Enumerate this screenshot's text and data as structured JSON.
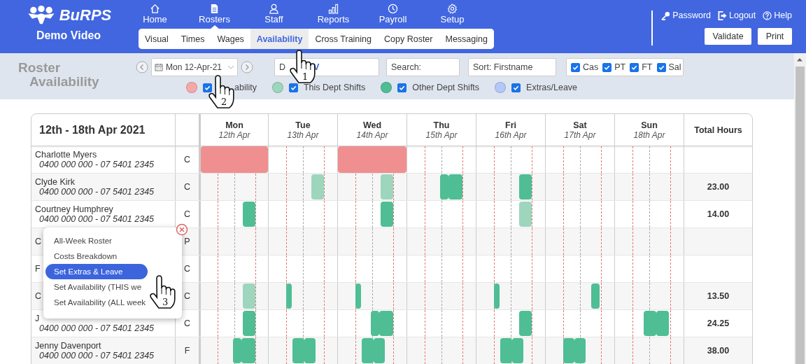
{
  "brand": {
    "logo": "BuRPS",
    "subtitle": "Demo Video"
  },
  "nav": [
    {
      "label": "Home",
      "selected": false
    },
    {
      "label": "Rosters",
      "selected": true
    },
    {
      "label": "Staff",
      "selected": false
    },
    {
      "label": "Reports",
      "selected": false
    },
    {
      "label": "Payroll",
      "selected": false
    },
    {
      "label": "Setup",
      "selected": false
    }
  ],
  "subnav": [
    {
      "label": "Visual",
      "selected": false
    },
    {
      "label": "Times",
      "selected": false
    },
    {
      "label": "Wages",
      "selected": false
    },
    {
      "label": "Availability",
      "selected": true
    },
    {
      "label": "Cross Training",
      "selected": false
    },
    {
      "label": "Copy Roster",
      "selected": false
    },
    {
      "label": "Messaging",
      "selected": false
    }
  ],
  "account_links": [
    "Password",
    "Logout",
    "Help"
  ],
  "buttons": [
    "Validate",
    "Print"
  ],
  "toolbar": {
    "title": [
      "Roster",
      "Availability"
    ],
    "date": "Mon 12-Apr-21",
    "department": {
      "label": "D",
      "value": "V"
    },
    "search": {
      "placeholder": "Search:"
    },
    "sort": "Sort: Firstname",
    "employment": [
      {
        "label": "Cas",
        "checked": true
      },
      {
        "label": "PT",
        "checked": true
      },
      {
        "label": "FT",
        "checked": true
      },
      {
        "label": "Sal",
        "checked": true
      }
    ],
    "legend": [
      {
        "label": "ability",
        "color": "#f4a9a9",
        "checked": true
      },
      {
        "label": "This Dept Shifts",
        "color": "#9dd6bd",
        "checked": true
      },
      {
        "label": "Other Dept Shifts",
        "color": "#4fbe95",
        "checked": true
      },
      {
        "label": "Extras/Leave",
        "color": "#b3c8f7",
        "checked": true
      }
    ]
  },
  "roster": {
    "week": "12th - 18th Apr 2021",
    "total_heading": "Total Hours",
    "days": [
      {
        "day": "Mon",
        "date": "12th Apr"
      },
      {
        "day": "Tue",
        "date": "13th Apr"
      },
      {
        "day": "Wed",
        "date": "14th Apr"
      },
      {
        "day": "Thu",
        "date": "15th Apr"
      },
      {
        "day": "Fri",
        "date": "16th Apr"
      },
      {
        "day": "Sat",
        "date": "17th Apr"
      },
      {
        "day": "Sun",
        "date": "18th Apr"
      }
    ],
    "rows": [
      {
        "name": "Charlotte Myers",
        "phone": "0400 000 000 - 07 5401 2345",
        "type": "C",
        "shifts": {
          "mon": [
            {
              "kind": "all_day",
              "color": "#f08f8f"
            }
          ],
          "wed": [
            {
              "kind": "all_day",
              "color": "#f08f8f"
            }
          ]
        }
      },
      {
        "name": "Clyde Kirk",
        "phone": "0400 000 000 - 07 5401 2345",
        "type": "C",
        "total": "23.00",
        "shifts": {
          "tue": [
            {
              "kind": "late",
              "color": "#9dd6bd"
            }
          ],
          "wed": [
            {
              "kind": "late",
              "color": "#9dd6bd"
            }
          ],
          "thu": [
            {
              "kind": "midday_split",
              "color": "#4fbe95"
            }
          ],
          "fri": [
            {
              "kind": "late",
              "color": "#4fbe95"
            }
          ]
        }
      },
      {
        "name": "Courtney Humphrey",
        "phone": "0400 000 000 - 07 5401 2345",
        "type": "C",
        "total": "14.00",
        "shifts": {
          "mon": [
            {
              "kind": "late",
              "color": "#4fbe95"
            }
          ],
          "wed": [
            {
              "kind": "late",
              "color": "#4fbe95"
            }
          ],
          "fri": [
            {
              "kind": "late",
              "color": "#9dd6bd"
            }
          ]
        }
      },
      {
        "name": "C",
        "type": "P"
      },
      {
        "name": "F",
        "type": "C"
      },
      {
        "name": "C",
        "type": "C",
        "total": "13.50",
        "shifts": {
          "mon": [
            {
              "kind": "late",
              "color": "#9dd6bd"
            }
          ],
          "tue": [
            {
              "kind": "early",
              "color": "#4fbe95"
            }
          ],
          "wed": [
            {
              "kind": "early",
              "color": "#4fbe95"
            }
          ],
          "fri": [
            {
              "kind": "early",
              "color": "#4fbe95"
            }
          ],
          "sat": [
            {
              "kind": "evening",
              "color": "#4fbe95"
            }
          ]
        }
      },
      {
        "name": "J",
        "phone": "0400 000 000 - 07 5401 2345",
        "type": "C",
        "total": "24.25",
        "shifts": {
          "mon": [
            {
              "kind": "late",
              "color": "#4fbe95"
            }
          ],
          "wed": [
            {
              "kind": "midday_split",
              "color": "#4fbe95"
            }
          ],
          "fri": [
            {
              "kind": "late",
              "color": "#4fbe95"
            }
          ],
          "sun": [
            {
              "kind": "noon_split",
              "color": "#4fbe95"
            }
          ]
        }
      },
      {
        "name": "Jenny Davenport",
        "phone": "0400 000 000 - 07 5401 2345",
        "type": "F",
        "total": "38.00",
        "shifts": {
          "mon": [
            {
              "kind": "midday_split",
              "color": "#4fbe95"
            }
          ],
          "tue": [
            {
              "kind": "day_split",
              "color": "#4fbe95"
            }
          ],
          "wed": [
            {
              "kind": "day_split",
              "color": "#4fbe95"
            }
          ],
          "fri": [
            {
              "kind": "day_split",
              "color": "#4fbe95"
            }
          ],
          "sat": [
            {
              "kind": "morning_split",
              "color": "#4fbe95"
            }
          ]
        }
      }
    ]
  },
  "context_menu": {
    "items": [
      {
        "label": "All-Week Roster",
        "selected": false
      },
      {
        "label": "Costs Breakdown",
        "selected": false
      },
      {
        "label": "Set Extras & Leave",
        "selected": true
      },
      {
        "label": "Set Availability (THIS we",
        "selected": false
      },
      {
        "label": "Set Availability (ALL week",
        "selected": false
      }
    ]
  },
  "annotations": [
    {
      "step": "1"
    },
    {
      "step": "2"
    },
    {
      "step": "3"
    }
  ]
}
